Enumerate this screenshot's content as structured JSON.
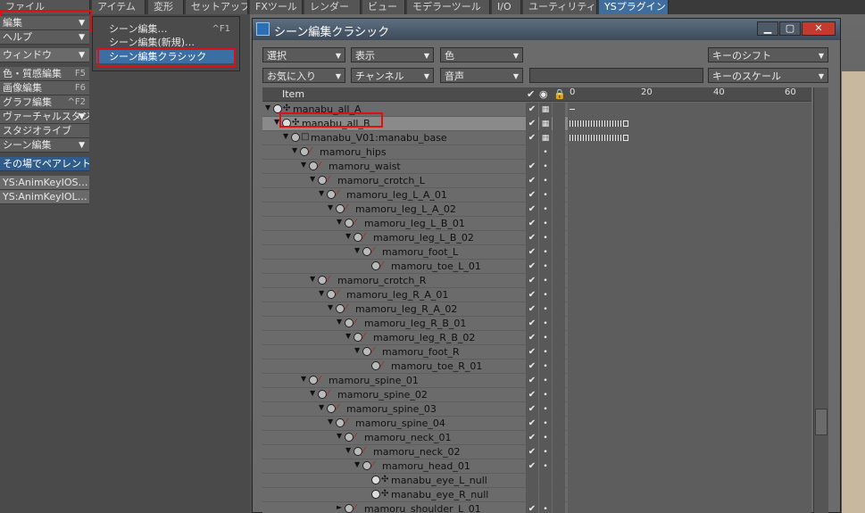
{
  "menu_tabs": [
    "ファイル",
    "アイテム",
    "変形",
    "セットアップ",
    "FXツール",
    "レンダー",
    "ビュー",
    "モデラーツール",
    "I/O",
    "ユーティリティ",
    "YSプラグイン"
  ],
  "sidebar": {
    "items": [
      {
        "label": "編集",
        "has_arrow": true
      },
      {
        "label": "ヘルプ",
        "has_arrow": true
      },
      {
        "label": "ウィンドウ",
        "has_arrow": true
      },
      {
        "label": "色・質感編集",
        "shortcut": "F5"
      },
      {
        "label": "画像編集",
        "shortcut": "F6"
      },
      {
        "label": "グラフ編集",
        "shortcut": "^F2"
      },
      {
        "label": "ヴァーチャルスタジオ",
        "has_arrow": true
      },
      {
        "label": "スタジオライブ"
      },
      {
        "label": "シーン編集",
        "has_arrow": true
      },
      {
        "label": "その場でペアレント"
      },
      {
        "label": "YS:AnimKeyIOS…"
      },
      {
        "label": "YS:AnimKeyIOL…"
      }
    ]
  },
  "edit_menu": {
    "items": [
      {
        "label": "シーン編集…",
        "shortcut": "^F1"
      },
      {
        "label": "シーン編集(新規)…"
      },
      {
        "label": "シーン編集クラシック"
      }
    ]
  },
  "window": {
    "title": "シーン編集クラシック",
    "buttons": [
      "▁",
      "▢",
      "✕"
    ],
    "toolbar_row1": [
      "選択",
      "表示",
      "色",
      "キーのシフト"
    ],
    "toolbar_row2": [
      "お気に入り",
      "チャンネル",
      "音声",
      "",
      "キーのスケール"
    ],
    "column_header": "Item",
    "ruler_labels": [
      "0",
      "20",
      "40",
      "60"
    ]
  },
  "tree": [
    {
      "name": "manabu_all_A",
      "depth": 0,
      "expand": "▼",
      "icon": "null",
      "check": true,
      "vis": "grid",
      "keys": false
    },
    {
      "name": "manabu_all_B",
      "depth": 1,
      "expand": "▼",
      "icon": "null",
      "check": true,
      "vis": "grid",
      "keys": true,
      "selected": true
    },
    {
      "name": "manabu_V01:manabu_base",
      "depth": 2,
      "expand": "▼",
      "icon": "mesh",
      "check": true,
      "vis": "grid",
      "keys": true
    },
    {
      "name": "mamoru_hips",
      "depth": 3,
      "expand": "▼",
      "icon": "bone",
      "check": false,
      "vis": "dot",
      "keys": false
    },
    {
      "name": "mamoru_waist",
      "depth": 4,
      "expand": "▼",
      "icon": "bone",
      "check": true,
      "vis": "dot",
      "keys": false
    },
    {
      "name": "mamoru_crotch_L",
      "depth": 5,
      "expand": "▼",
      "icon": "bone",
      "check": true,
      "vis": "dot",
      "keys": false
    },
    {
      "name": "mamoru_leg_L_A_01",
      "depth": 6,
      "expand": "▼",
      "icon": "bone",
      "check": true,
      "vis": "dot",
      "keys": false
    },
    {
      "name": "mamoru_leg_L_A_02",
      "depth": 7,
      "expand": "▼",
      "icon": "bone",
      "check": true,
      "vis": "dot",
      "keys": false
    },
    {
      "name": "mamoru_leg_L_B_01",
      "depth": 8,
      "expand": "▼",
      "icon": "bone",
      "check": true,
      "vis": "dot",
      "keys": false
    },
    {
      "name": "mamoru_leg_L_B_02",
      "depth": 9,
      "expand": "▼",
      "icon": "bone",
      "check": true,
      "vis": "dot",
      "keys": false
    },
    {
      "name": "mamoru_foot_L",
      "depth": 10,
      "expand": "▼",
      "icon": "bone",
      "check": true,
      "vis": "dot",
      "keys": false
    },
    {
      "name": "mamoru_toe_L_01",
      "depth": 11,
      "expand": "",
      "icon": "bone",
      "check": true,
      "vis": "dot",
      "keys": false
    },
    {
      "name": "mamoru_crotch_R",
      "depth": 5,
      "expand": "▼",
      "icon": "bone",
      "check": true,
      "vis": "dot",
      "keys": false
    },
    {
      "name": "mamoru_leg_R_A_01",
      "depth": 6,
      "expand": "▼",
      "icon": "bone",
      "check": true,
      "vis": "dot",
      "keys": false
    },
    {
      "name": "mamoru_leg_R_A_02",
      "depth": 7,
      "expand": "▼",
      "icon": "bone",
      "check": true,
      "vis": "dot",
      "keys": false
    },
    {
      "name": "mamoru_leg_R_B_01",
      "depth": 8,
      "expand": "▼",
      "icon": "bone",
      "check": true,
      "vis": "dot",
      "keys": false
    },
    {
      "name": "mamoru_leg_R_B_02",
      "depth": 9,
      "expand": "▼",
      "icon": "bone",
      "check": true,
      "vis": "dot",
      "keys": false
    },
    {
      "name": "mamoru_foot_R",
      "depth": 10,
      "expand": "▼",
      "icon": "bone",
      "check": true,
      "vis": "dot",
      "keys": false
    },
    {
      "name": "mamoru_toe_R_01",
      "depth": 11,
      "expand": "",
      "icon": "bone",
      "check": true,
      "vis": "dot",
      "keys": false
    },
    {
      "name": "mamoru_spine_01",
      "depth": 4,
      "expand": "▼",
      "icon": "bone",
      "check": true,
      "vis": "dot",
      "keys": false
    },
    {
      "name": "mamoru_spine_02",
      "depth": 5,
      "expand": "▼",
      "icon": "bone",
      "check": true,
      "vis": "dot",
      "keys": false
    },
    {
      "name": "mamoru_spine_03",
      "depth": 6,
      "expand": "▼",
      "icon": "bone",
      "check": true,
      "vis": "dot",
      "keys": false
    },
    {
      "name": "mamoru_spine_04",
      "depth": 7,
      "expand": "▼",
      "icon": "bone",
      "check": true,
      "vis": "dot",
      "keys": false
    },
    {
      "name": "mamoru_neck_01",
      "depth": 8,
      "expand": "▼",
      "icon": "bone",
      "check": true,
      "vis": "dot",
      "keys": false
    },
    {
      "name": "mamoru_neck_02",
      "depth": 9,
      "expand": "▼",
      "icon": "bone",
      "check": true,
      "vis": "dot",
      "keys": false
    },
    {
      "name": "mamoru_head_01",
      "depth": 10,
      "expand": "▼",
      "icon": "bone",
      "check": true,
      "vis": "dot",
      "keys": false
    },
    {
      "name": "manabu_eye_L_null",
      "depth": 11,
      "expand": "",
      "icon": "null",
      "check": false,
      "vis": "",
      "keys": false
    },
    {
      "name": "manabu_eye_R_null",
      "depth": 11,
      "expand": "",
      "icon": "null",
      "check": false,
      "vis": "",
      "keys": false
    },
    {
      "name": "mamoru_shoulder_L_01",
      "depth": 8,
      "expand": "►",
      "icon": "bone",
      "check": true,
      "vis": "dot",
      "keys": false
    }
  ],
  "colors": {
    "accent": "#3f6d9e",
    "highlight_box": "#e01010"
  }
}
